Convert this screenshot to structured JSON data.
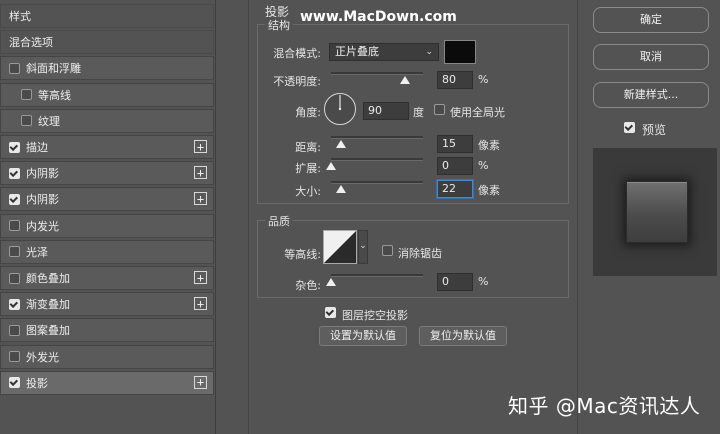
{
  "left_panel": {
    "items": [
      {
        "label": "样式",
        "type": "header",
        "checked": null,
        "plus": false
      },
      {
        "label": "混合选项",
        "type": "header",
        "checked": null,
        "plus": false
      },
      {
        "label": "斜面和浮雕",
        "type": "item",
        "checked": false,
        "plus": false
      },
      {
        "label": "等高线",
        "type": "sub",
        "checked": false,
        "plus": false
      },
      {
        "label": "纹理",
        "type": "sub",
        "checked": false,
        "plus": false
      },
      {
        "label": "描边",
        "type": "item",
        "checked": true,
        "plus": true
      },
      {
        "label": "内阴影",
        "type": "item",
        "checked": true,
        "plus": true
      },
      {
        "label": "内阴影",
        "type": "item",
        "checked": true,
        "plus": true
      },
      {
        "label": "内发光",
        "type": "item",
        "checked": false,
        "plus": false
      },
      {
        "label": "光泽",
        "type": "item",
        "checked": false,
        "plus": false
      },
      {
        "label": "颜色叠加",
        "type": "item",
        "checked": false,
        "plus": true
      },
      {
        "label": "渐变叠加",
        "type": "item",
        "checked": true,
        "plus": true
      },
      {
        "label": "图案叠加",
        "type": "item",
        "checked": false,
        "plus": false
      },
      {
        "label": "外发光",
        "type": "item",
        "checked": false,
        "plus": false
      },
      {
        "label": "投影",
        "type": "item",
        "checked": true,
        "plus": true,
        "selected": true
      }
    ],
    "plus_glyph": "+"
  },
  "drop_shadow": {
    "title": "投影",
    "structure": {
      "title": "结构",
      "blend_mode_label": "混合模式:",
      "blend_mode_value": "正片叠底",
      "blend_color": "#0b0b0b",
      "opacity_label": "不透明度:",
      "opacity_value": "80",
      "opacity_unit": "%",
      "opacity_percent": 80,
      "angle_label": "角度:",
      "angle_value": "90",
      "angle_unit": "度",
      "global_light_label": "使用全局光",
      "global_light_checked": false,
      "distance_label": "距离:",
      "distance_value": "15",
      "distance_unit": "像素",
      "spread_label": "扩展:",
      "spread_value": "0",
      "spread_unit": "%",
      "size_label": "大小:",
      "size_value": "22",
      "size_unit": "像素"
    },
    "quality": {
      "title": "品质",
      "contour_label": "等高线:",
      "anti_alias_label": "消除锯齿",
      "anti_alias_checked": false,
      "noise_label": "杂色:",
      "noise_value": "0",
      "noise_unit": "%"
    },
    "knockout_label": "图层挖空投影",
    "knockout_checked": true,
    "set_default_label": "设置为默认值",
    "reset_default_label": "复位为默认值"
  },
  "right_panel": {
    "ok_label": "确定",
    "cancel_label": "取消",
    "new_style_label": "新建样式...",
    "preview_label": "预览",
    "preview_checked": true
  },
  "watermarks": {
    "site": "www.MacDown.com",
    "author": "知乎 @Mac资讯达人"
  }
}
